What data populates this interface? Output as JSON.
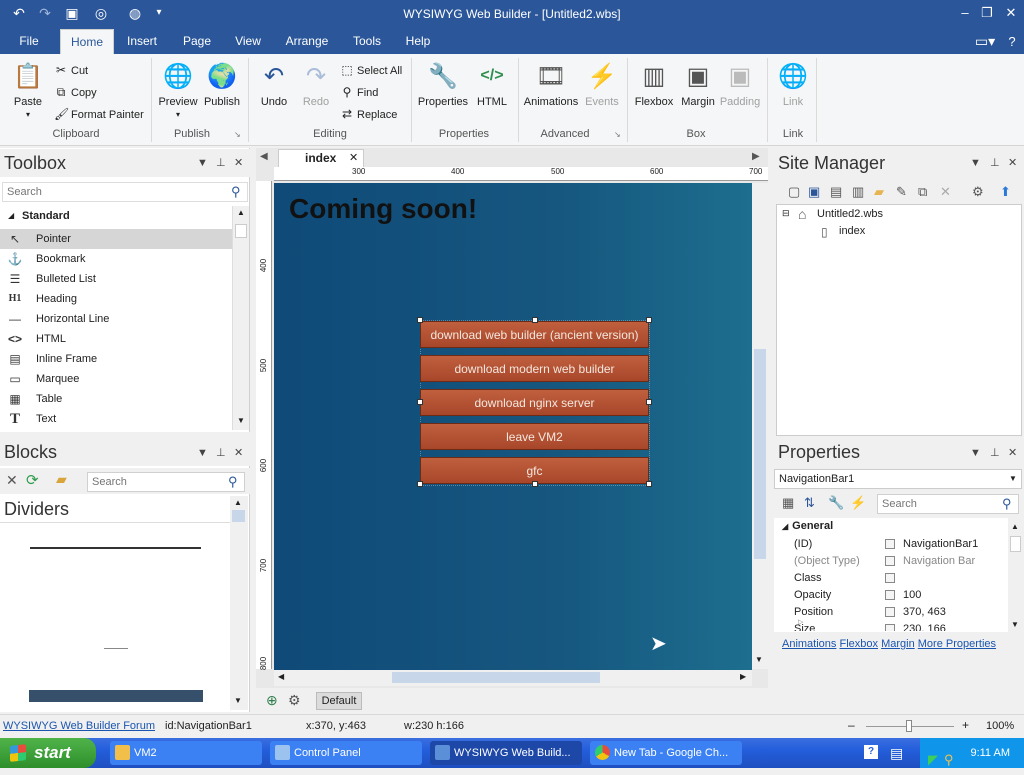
{
  "app": {
    "title": "WYSIWYG Web Builder - [Untitled2.wbs]"
  },
  "menu_tabs": [
    "File",
    "Home",
    "Insert",
    "Page",
    "View",
    "Arrange",
    "Tools",
    "Help"
  ],
  "ribbon": {
    "clipboard": {
      "paste": "Paste",
      "cut": "Cut",
      "copy": "Copy",
      "format_painter": "Format Painter",
      "label": "Clipboard"
    },
    "publish": {
      "preview": "Preview",
      "publish": "Publish",
      "label": "Publish"
    },
    "editing": {
      "undo": "Undo",
      "redo": "Redo",
      "select_all": "Select All",
      "find": "Find",
      "replace": "Replace",
      "label": "Editing"
    },
    "properties": {
      "properties": "Properties",
      "html": "HTML",
      "label": "Properties"
    },
    "advanced": {
      "animations": "Animations",
      "events": "Events",
      "label": "Advanced"
    },
    "box": {
      "flexbox": "Flexbox",
      "margin": "Margin",
      "padding": "Padding",
      "label": "Box"
    },
    "link": {
      "link": "Link",
      "label": "Link"
    }
  },
  "toolbox": {
    "title": "Toolbox",
    "search_placeholder": "Search",
    "category": "Standard",
    "items": [
      {
        "label": "Pointer",
        "icon": "pointer-icon"
      },
      {
        "label": "Bookmark",
        "icon": "anchor-icon"
      },
      {
        "label": "Bulleted List",
        "icon": "list-icon"
      },
      {
        "label": "Heading",
        "icon": "heading-icon"
      },
      {
        "label": "Horizontal Line",
        "icon": "hline-icon"
      },
      {
        "label": "HTML",
        "icon": "code-icon"
      },
      {
        "label": "Inline Frame",
        "icon": "iframe-icon"
      },
      {
        "label": "Marquee",
        "icon": "marquee-icon"
      },
      {
        "label": "Table",
        "icon": "table-icon"
      },
      {
        "label": "Text",
        "icon": "text-icon"
      }
    ]
  },
  "blocks": {
    "title": "Blocks",
    "search_placeholder": "Search",
    "section": "Dividers"
  },
  "editor": {
    "tab": "index",
    "ruler_top": [
      "300",
      "400",
      "500",
      "600",
      "700"
    ],
    "ruler_left": [
      "400",
      "500",
      "600",
      "700",
      "800"
    ],
    "heading": "Coming soon!",
    "nav_buttons": [
      "download web builder (ancient version)",
      "download modern web builder",
      "download nginx server",
      "leave VM2",
      "gfc"
    ],
    "layout_label": "Default"
  },
  "site_manager": {
    "title": "Site Manager",
    "root": "Untitled2.wbs",
    "page": "index"
  },
  "properties": {
    "title": "Properties",
    "selected": "NavigationBar1",
    "search_placeholder": "Search",
    "category": "General",
    "rows": [
      {
        "key": "(ID)",
        "value": "NavigationBar1"
      },
      {
        "key": "(Object Type)",
        "value": "Navigation Bar"
      },
      {
        "key": "Class",
        "value": ""
      },
      {
        "key": "Opacity",
        "value": "100"
      },
      {
        "key": "Position",
        "value": "370, 463"
      },
      {
        "key": "Size",
        "value": "230, 166"
      }
    ],
    "links": [
      "Animations",
      "Flexbox",
      "Margin",
      "More Properties"
    ]
  },
  "status": {
    "forum": "WYSIWYG Web Builder Forum",
    "id": "id:NavigationBar1",
    "pos": "x:370, y:463",
    "size": "w:230 h:166",
    "zoom": "100%"
  },
  "taskbar": {
    "start": "start",
    "tasks": [
      "VM2",
      "Control Panel",
      "WYSIWYG Web Build...",
      "New Tab - Google Ch..."
    ],
    "clock": "9:11 AM"
  },
  "colors": {
    "accent": "#2b579a",
    "nav_button": "#b3522f",
    "canvas": "#16577f"
  }
}
